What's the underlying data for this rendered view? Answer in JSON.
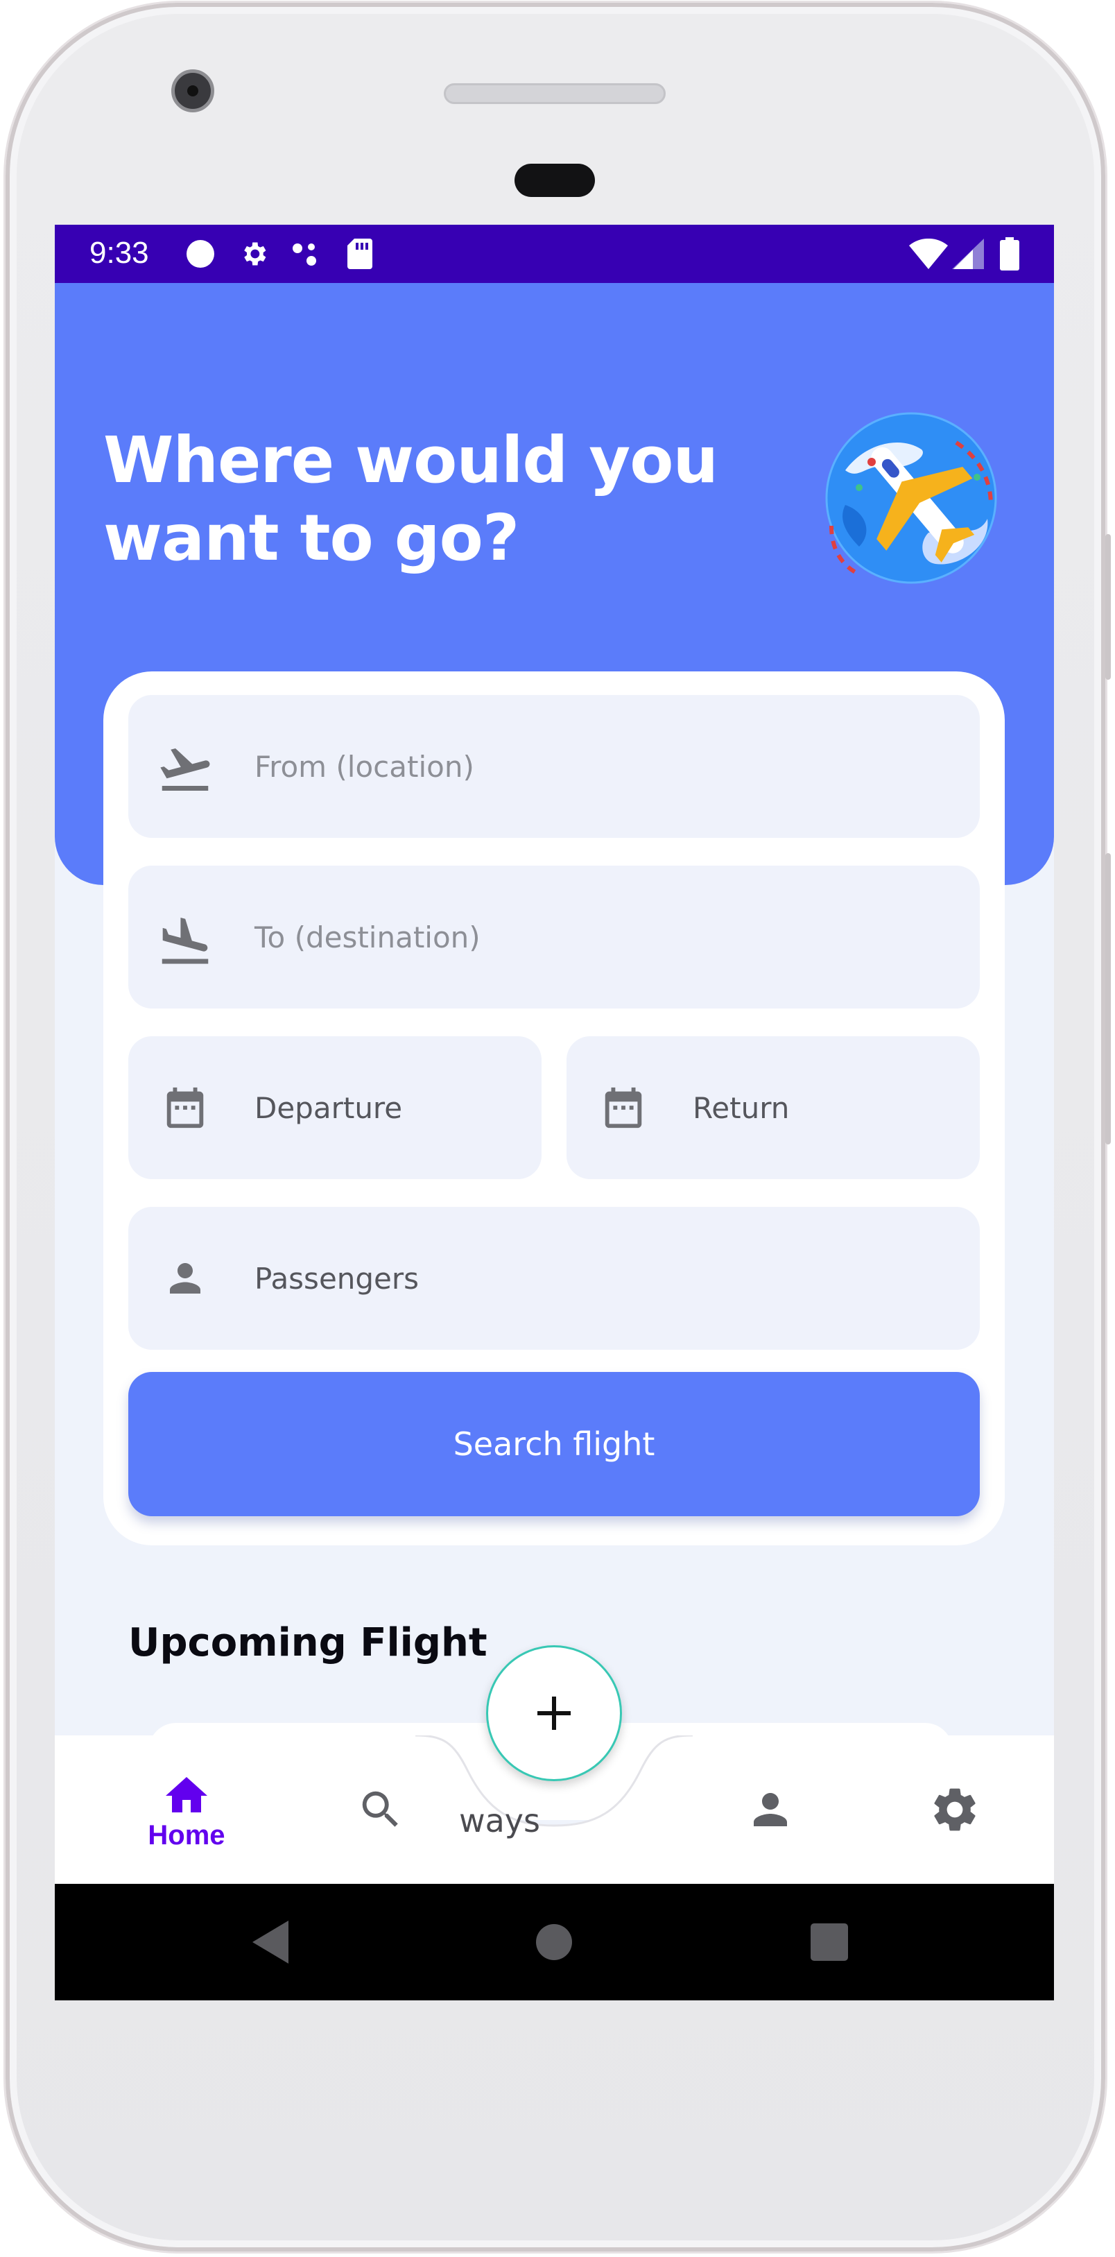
{
  "status_bar": {
    "time": "9:33",
    "icons": [
      "circle-icon",
      "gear-icon",
      "dots-icon",
      "sd-card-icon",
      "wifi-icon",
      "signal-icon",
      "battery-icon"
    ],
    "background": "#3700b3"
  },
  "hero": {
    "title_line1": "Where would you",
    "title_line2": "want to go?",
    "illustration": "globe-airplane-icon",
    "background": "#5b7cfa"
  },
  "form": {
    "from_placeholder": "From (location)",
    "to_placeholder": "To (destination)",
    "departure_label": "Departure",
    "return_label": "Return",
    "passengers_label": "Passengers",
    "search_button": "Search flight"
  },
  "upcoming": {
    "title": "Upcoming Flight"
  },
  "bottom_nav": {
    "items": [
      {
        "label": "Home",
        "icon": "home-icon",
        "active": true
      },
      {
        "label": "",
        "icon": "search-icon",
        "active": false
      },
      {
        "label": "ways",
        "icon": "",
        "active": false
      },
      {
        "label": "",
        "icon": "person-icon",
        "active": false
      },
      {
        "label": "",
        "icon": "gear-icon",
        "active": false
      }
    ],
    "fab_icon": "plus-icon",
    "active_color": "#6200ee"
  },
  "system_nav": {
    "buttons": [
      "back-icon",
      "home-circle-icon",
      "recents-icon"
    ]
  }
}
